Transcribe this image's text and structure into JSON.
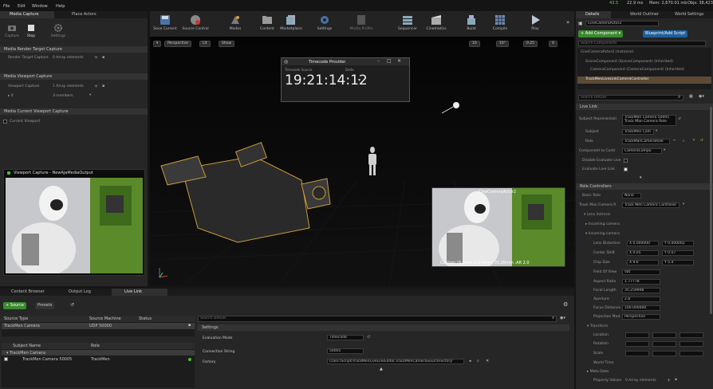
{
  "menu": [
    "File",
    "Edit",
    "Window",
    "Help"
  ],
  "status_bar": {
    "fps": "43.5",
    "ms": "22.9 ms",
    "mem": "Mem: 2,670.01 mb",
    "objs": "Objs: 38,423"
  },
  "top_tabs": {
    "media_capture": "Media Capture",
    "place_actors": "Place Actors",
    "details": "Details",
    "world_outliner": "World Outliner",
    "world_settings": "World Settings"
  },
  "media_capture": {
    "buttons": [
      "Capture",
      "Stop",
      "Settings"
    ],
    "sections": [
      "Media Render Target Capture",
      "Media Viewport Capture",
      "Media Current Viewport Capture"
    ],
    "render_target_label": "Render Target Capture",
    "render_target_value": "0 Array elements",
    "viewport_capture_label": "Viewport Capture",
    "viewport_capture_value": "1 Array elements",
    "index_label": "▸ 0",
    "index_value": "3 members",
    "current_viewport_label": "Current Viewport",
    "preview_title": "Viewport Capture - NewAjaMediaOutput"
  },
  "toolbar": [
    {
      "label": "Save Current",
      "icon": "save-icon"
    },
    {
      "label": "Source Control",
      "icon": "source-control-icon"
    },
    {
      "label": "Modes",
      "icon": "modes-icon"
    },
    {
      "label": "Content",
      "icon": "content-icon"
    },
    {
      "label": "Marketplace",
      "icon": "marketplace-icon"
    },
    {
      "label": "Settings",
      "icon": "settings-icon"
    },
    {
      "label": "Media Profile",
      "icon": "media-profile-icon"
    },
    {
      "label": "Sequencer",
      "icon": "sequencer-icon"
    },
    {
      "label": "Cinematics",
      "icon": "cinematics-icon"
    },
    {
      "label": "Build",
      "icon": "build-icon"
    },
    {
      "label": "Compile",
      "icon": "compile-icon"
    },
    {
      "label": "Play",
      "icon": "play-icon"
    }
  ],
  "viewport": {
    "perspective": "Perspective",
    "lit": "Lit",
    "show": "Show",
    "grid_snap": "10",
    "rot_snap": "10°",
    "scale_snap": "0.25",
    "cam_speed": "4",
    "pip_title": "CineCameraActor2",
    "pip_caption": "Custom (9.6mm x 5.4mm) 35.26mm :AR 2.0",
    "timecode_title": "Timecode Provider",
    "timecode_source": "Timecode Source",
    "timecode_right": "Delta",
    "timecode": "19:21:14:12"
  },
  "bottom_tabs": {
    "content_browser": "Content Browser",
    "output_log": "Output Log",
    "live_link": "Live Link"
  },
  "live_link": {
    "source_btn": "+ Source",
    "presets_btn": "Presets",
    "source_headers": [
      "Source Type",
      "Source Machine",
      "Status"
    ],
    "source_row": [
      "TrackMen Camera",
      "UDP 50000",
      ""
    ],
    "subject_headers": [
      "Subject Name",
      "Role"
    ],
    "group_row": "▾ TrackMen Camera",
    "subject_row": [
      "TrackMen Camera 50005",
      "TrackMen"
    ],
    "search_placeholder": "Search Details",
    "settings_label": "Settings",
    "evaluation_mode_label": "Evaluation Mode",
    "evaluation_mode_value": "Timecode",
    "connection_string_label": "Connection String",
    "connection_string_value": "50005",
    "factory_label": "Factory",
    "factory_value": "Class'/Script/TrackMenLiveLinkEditor.TrackMenCameraSourceFactory'"
  },
  "details": {
    "actor_name": "CineCameraActor2",
    "add_component": "+ Add Component ▾",
    "blueprint": "Blueprint/Add Script",
    "search_components": "Search Components",
    "components": [
      "CineCameraActor2 (Instance)",
      "SceneComponent (SceneComponent) (Inherited)",
      "CameraComponent (CameraComponent) (Inherited)",
      "TrackMenLiveLinkCameraController"
    ],
    "search_details": "Search Details",
    "live_link_section": "Live Link",
    "subject_rep_label": "Subject Representati",
    "subject_rep_value": "TrackMen Camera 50005",
    "subject_rep_sub": "Track Man Camera Role",
    "subject_label": "Subject",
    "subject_value": "TrackMen Cam",
    "role_label": "Role",
    "role_value": "TrackManCameraRole",
    "component_label": "Component to Contr",
    "component_value": "CameraCompo",
    "disable_eval_label": "Disable Evaluate Live",
    "evaluate_label": "Evaluate Live Link",
    "role_controllers_section": "Role Controllers",
    "basic_role_label": "Basic Role",
    "basic_role_value": "None",
    "trackman_camera_label": "Track Man Camera R",
    "trackman_camera_value": "Track Men Camera Controller",
    "lens_fov_label": "▾ Lens Intrinsic",
    "incoming_camera_label": "▸ Incoming camera",
    "incoming_camera2_label": "▾ Incoming camera",
    "lens_distortion_label": "Lens Distortion",
    "lens_distortion_x": "X 0.000000",
    "lens_distortion_y": "Y 0.000002",
    "center_shift_label": "Center Shift",
    "center_shift_x": "X 0.05",
    "center_shift_y": "Y 0.07",
    "chip_size_label": "Chip Size",
    "chip_size_x": "X 9.6",
    "chip_size_y": "Y 5.4",
    "fov_label": "Field Of View",
    "fov_value": "Vat",
    "aspect_label": "Aspect Ratio",
    "aspect_value": "1.77778",
    "focal_label": "Focal Length",
    "focal_value": "35.259998",
    "aperture_label": "Aperture",
    "aperture_value": "2.8",
    "focus_label": "Focus Distance",
    "focus_value": "100.000000",
    "projection_label": "Projection Mod",
    "projection_value": "Perspective",
    "transform_label": "▾ Transform",
    "location_label": "Location",
    "rotation_label": "Rotation",
    "scale_label": "Scale",
    "world_time_label": "World Time",
    "meta_data_label": "▸ Meta Data",
    "property_values_label": "Property Values",
    "property_values_value": "0 Array elements"
  }
}
